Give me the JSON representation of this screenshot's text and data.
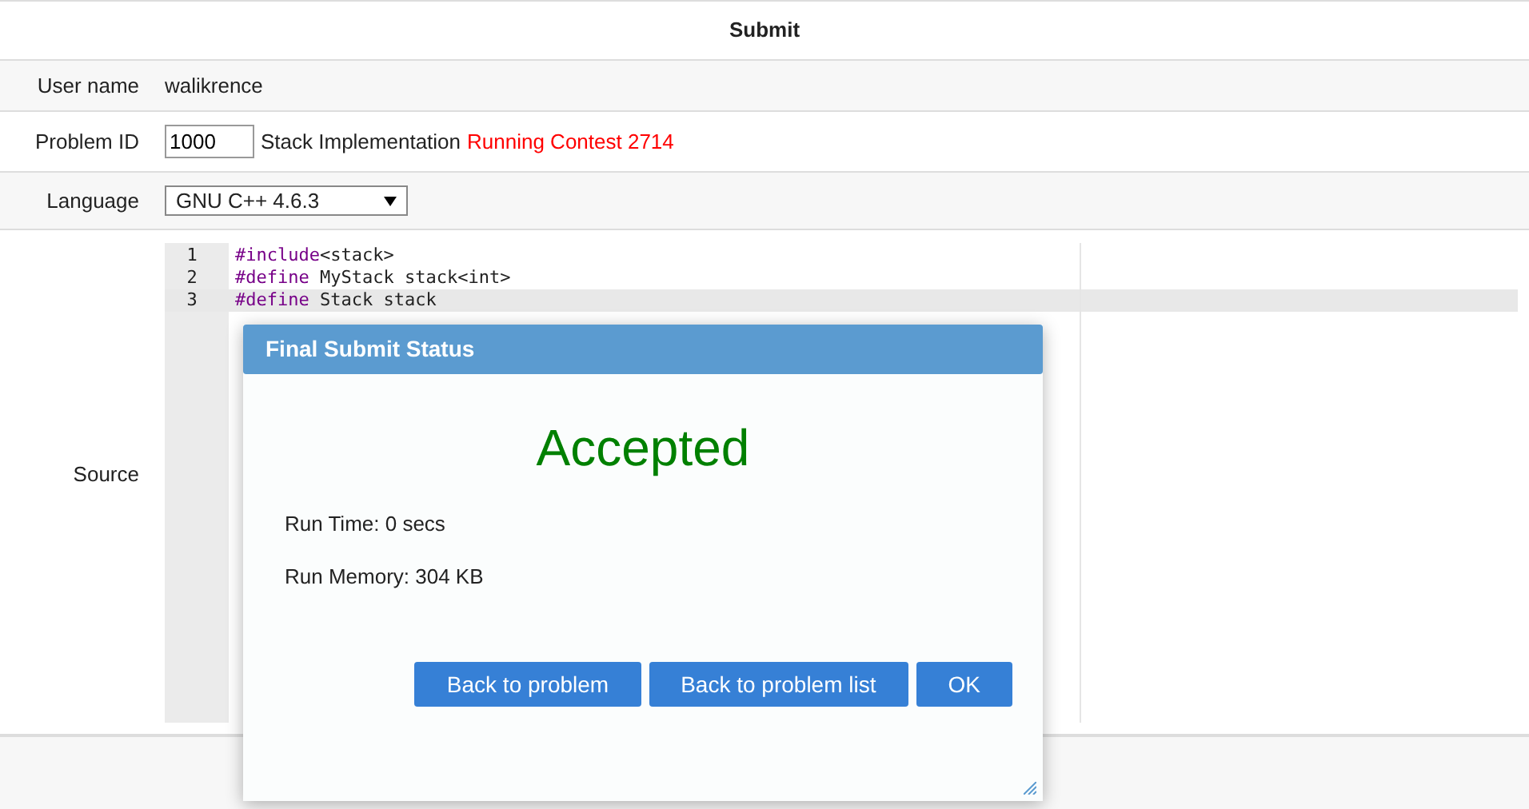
{
  "form_title": "Submit",
  "user_name": {
    "label": "User name",
    "value": "walikrence"
  },
  "problem": {
    "label": "Problem ID",
    "id_value": "1000",
    "title": "Stack Implementation",
    "contest": "Running Contest 2714"
  },
  "language": {
    "label": "Language",
    "value": "GNU C++ 4.6.3"
  },
  "source": {
    "label": "Source",
    "lines": [
      {
        "number": "1",
        "directive": "#include",
        "rest": "<stack>",
        "active": false
      },
      {
        "number": "2",
        "directive": "#define",
        "rest": " MyStack stack<int>",
        "active": false
      },
      {
        "number": "3",
        "directive": "#define",
        "rest": " Stack stack",
        "active": true
      }
    ]
  },
  "dialog": {
    "title": "Final Submit Status",
    "verdict": "Accepted",
    "details": [
      "Run Time: 0 secs",
      "Run Memory: 304 KB"
    ],
    "buttons": [
      "Back to problem",
      "Back to problem list",
      "OK"
    ]
  }
}
